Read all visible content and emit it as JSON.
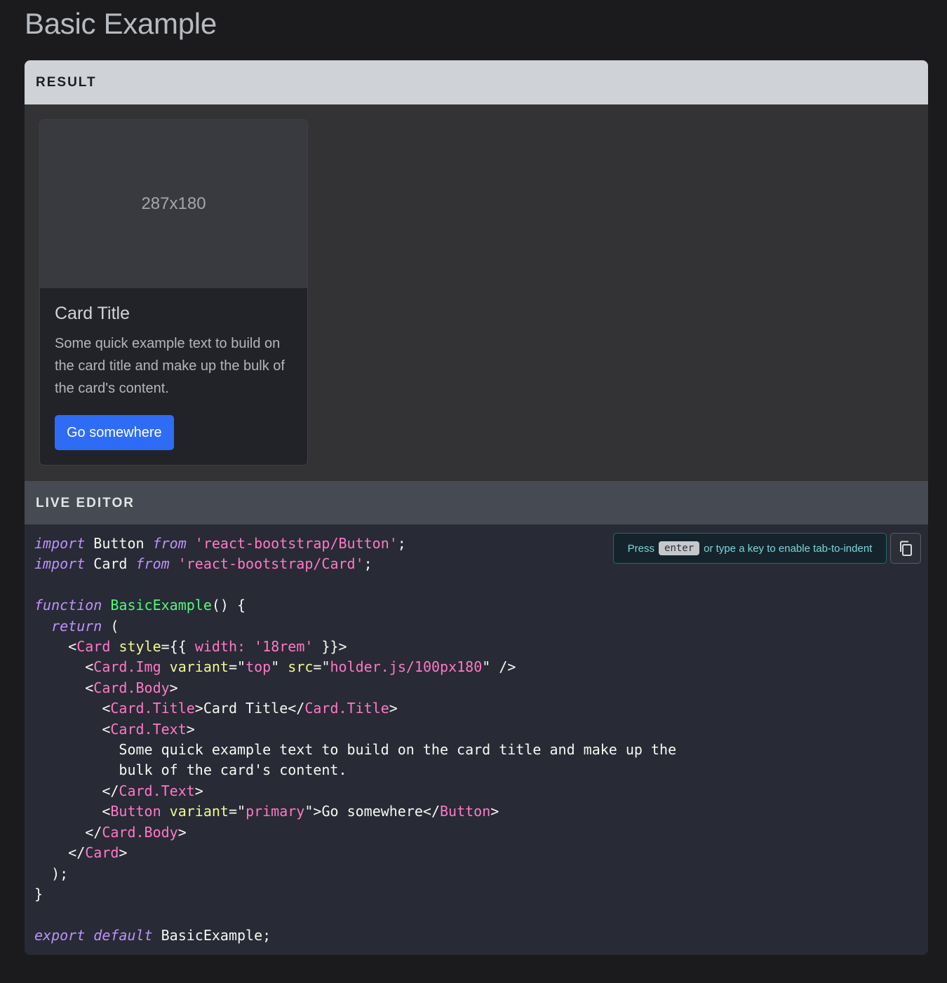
{
  "page": {
    "title": "Basic Example"
  },
  "result": {
    "header": "RESULT",
    "card": {
      "image_placeholder": "287x180",
      "title": "Card Title",
      "text": "Some quick example text to build on the card title and make up the bulk of the card's content.",
      "button_label": "Go somewhere"
    }
  },
  "editor": {
    "header": "LIVE EDITOR",
    "hint": {
      "press": "Press",
      "key": "enter",
      "rest": "or type a key to enable tab-to-indent"
    },
    "copy_icon": "copy-icon",
    "code_lines": [
      [
        {
          "t": "import",
          "c": "kw"
        },
        {
          "t": " Button "
        },
        {
          "t": "from",
          "c": "kw"
        },
        {
          "t": " "
        },
        {
          "t": "'react-bootstrap/Button'",
          "c": "str"
        },
        {
          "t": ";"
        }
      ],
      [
        {
          "t": "import",
          "c": "kw"
        },
        {
          "t": " Card "
        },
        {
          "t": "from",
          "c": "kw"
        },
        {
          "t": " "
        },
        {
          "t": "'react-bootstrap/Card'",
          "c": "str"
        },
        {
          "t": ";"
        }
      ],
      [],
      [
        {
          "t": "function",
          "c": "kw"
        },
        {
          "t": " "
        },
        {
          "t": "BasicExample",
          "c": "fn"
        },
        {
          "t": "() {"
        }
      ],
      [
        {
          "t": "  "
        },
        {
          "t": "return",
          "c": "kw"
        },
        {
          "t": " ("
        }
      ],
      [
        {
          "t": "    <"
        },
        {
          "t": "Card",
          "c": "tag"
        },
        {
          "t": " "
        },
        {
          "t": "style",
          "c": "attr"
        },
        {
          "t": "={{ "
        },
        {
          "t": "width:",
          "c": "str"
        },
        {
          "t": " "
        },
        {
          "t": "'18rem'",
          "c": "str"
        },
        {
          "t": " }}>"
        }
      ],
      [
        {
          "t": "      <"
        },
        {
          "t": "Card.Img",
          "c": "tag"
        },
        {
          "t": " "
        },
        {
          "t": "variant",
          "c": "attr"
        },
        {
          "t": "=\""
        },
        {
          "t": "top",
          "c": "str"
        },
        {
          "t": "\" "
        },
        {
          "t": "src",
          "c": "attr"
        },
        {
          "t": "=\""
        },
        {
          "t": "holder.js/100px180",
          "c": "str"
        },
        {
          "t": "\" />"
        }
      ],
      [
        {
          "t": "      <"
        },
        {
          "t": "Card.Body",
          "c": "tag"
        },
        {
          "t": ">"
        }
      ],
      [
        {
          "t": "        <"
        },
        {
          "t": "Card.Title",
          "c": "tag"
        },
        {
          "t": ">Card Title</"
        },
        {
          "t": "Card.Title",
          "c": "tag"
        },
        {
          "t": ">"
        }
      ],
      [
        {
          "t": "        <"
        },
        {
          "t": "Card.Text",
          "c": "tag"
        },
        {
          "t": ">"
        }
      ],
      [
        {
          "t": "          Some quick example text to build on the card title and make up the"
        }
      ],
      [
        {
          "t": "          bulk of the card's content."
        }
      ],
      [
        {
          "t": "        </"
        },
        {
          "t": "Card.Text",
          "c": "tag"
        },
        {
          "t": ">"
        }
      ],
      [
        {
          "t": "        <"
        },
        {
          "t": "Button",
          "c": "tag"
        },
        {
          "t": " "
        },
        {
          "t": "variant",
          "c": "attr"
        },
        {
          "t": "=\""
        },
        {
          "t": "primary",
          "c": "str"
        },
        {
          "t": "\">Go somewhere</"
        },
        {
          "t": "Button",
          "c": "tag"
        },
        {
          "t": ">"
        }
      ],
      [
        {
          "t": "      </"
        },
        {
          "t": "Card.Body",
          "c": "tag"
        },
        {
          "t": ">"
        }
      ],
      [
        {
          "t": "    </"
        },
        {
          "t": "Card",
          "c": "tag"
        },
        {
          "t": ">"
        }
      ],
      [
        {
          "t": "  );"
        }
      ],
      [
        {
          "t": "}"
        }
      ],
      [],
      [
        {
          "t": "export",
          "c": "kw"
        },
        {
          "t": " "
        },
        {
          "t": "default",
          "c": "kw"
        },
        {
          "t": " BasicExample;"
        }
      ]
    ]
  }
}
